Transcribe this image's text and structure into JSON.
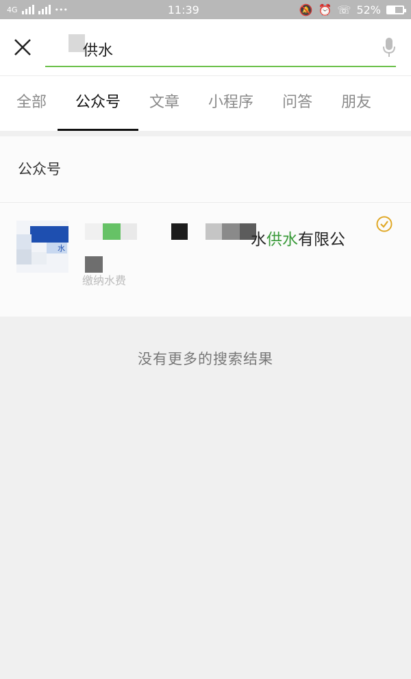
{
  "status_bar": {
    "network": "4G",
    "time": "11:39",
    "battery": "52%",
    "battery_level": 0.52
  },
  "search": {
    "query": "供水"
  },
  "tabs": [
    {
      "label": "全部",
      "active": false
    },
    {
      "label": "公众号",
      "active": true
    },
    {
      "label": "文章",
      "active": false
    },
    {
      "label": "小程序",
      "active": false
    },
    {
      "label": "问答",
      "active": false
    },
    {
      "label": "朋友",
      "active": false
    }
  ],
  "results": {
    "section_title": "公众号",
    "item": {
      "name_prefix": "水",
      "name_highlight": "供水",
      "name_suffix": "有限公",
      "subtitle": "缴纳水费"
    },
    "empty_message": "没有更多的搜索结果"
  },
  "colors": {
    "accent_green": "#6cc04a",
    "verified_gold": "#e0a826"
  }
}
